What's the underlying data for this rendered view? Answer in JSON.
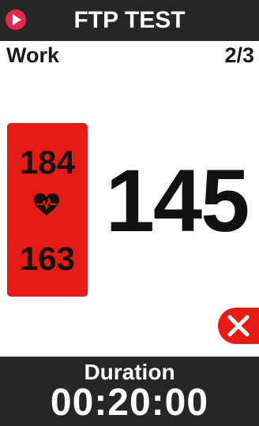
{
  "header": {
    "title": "FTP TEST",
    "play_icon": "play-icon",
    "accent_color": "#e8264f",
    "background_color": "#262626"
  },
  "step": {
    "name": "Work",
    "progress": "2/3"
  },
  "heart_rate": {
    "max": "184",
    "min": "163",
    "icon": "heart-pulse-icon",
    "panel_color": "#e51b16"
  },
  "power": {
    "value": "145"
  },
  "close_button": {
    "icon": "close-icon",
    "color": "#e51b16"
  },
  "footer": {
    "label": "Duration",
    "value": "00:20:00"
  }
}
